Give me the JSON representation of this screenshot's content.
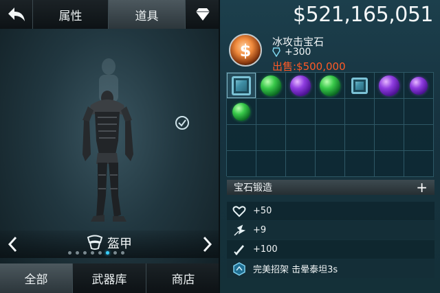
{
  "top_tabs": {
    "attributes": "属性",
    "items": "道具"
  },
  "icons": {
    "back": "back-arrow-icon",
    "gem_store": "diamond-icon",
    "check": "check-circle-icon",
    "slot": "armor-icon"
  },
  "selector": {
    "slot_label": "盔甲",
    "page_count": 8,
    "active_page": 6
  },
  "bottom_tabs": {
    "all": "全部",
    "armory": "武器库",
    "shop": "商店"
  },
  "currency": "$521,165,051",
  "item": {
    "name": "冰攻击宝石",
    "stat": "+300",
    "sell": "出售:$500,000"
  },
  "grid": {
    "columns": 7,
    "rows": 4,
    "cells": [
      {
        "gem": "blue-square",
        "selected": true
      },
      {
        "gem": "green"
      },
      {
        "gem": "purple"
      },
      {
        "gem": "green"
      },
      {
        "gem": "blue-square-small"
      },
      {
        "gem": "purple"
      },
      {
        "gem": "purple-small"
      },
      {
        "gem": "green-small"
      }
    ]
  },
  "forge": {
    "label": "宝石锻造",
    "plus": "+"
  },
  "stats": [
    {
      "icon": "heart-icon",
      "value": "+50"
    },
    {
      "icon": "attack-icon",
      "value": "+9"
    },
    {
      "icon": "sword-icon",
      "value": "+100"
    },
    {
      "icon": "perk-hex-icon",
      "value": "完美招架 击晕泰坦3s"
    }
  ],
  "colors": {
    "sell_price": "#ff5a26",
    "active_dot": "#39d0ff"
  }
}
